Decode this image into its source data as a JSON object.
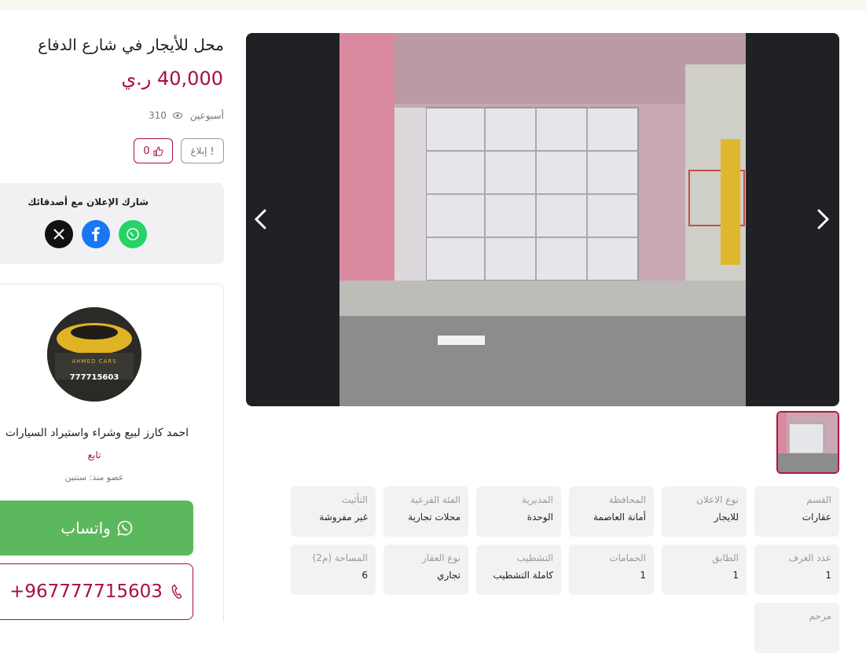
{
  "listing": {
    "title": "محل للأيجار في شارع الدفاع",
    "price": "40,000 ر.ي",
    "age": "أسبوعين",
    "views": "310",
    "likes": "0",
    "report_label": "إبلاغ"
  },
  "share": {
    "title": "شارك الإعلان مع أصدقائك",
    "icons": [
      "x-icon",
      "facebook-icon",
      "whatsapp-icon"
    ]
  },
  "seller": {
    "name": "احمد كارز لبيع وشراء واستيراد السيارات",
    "follow_label": "تابع",
    "member_since": "عضو منذ: سنتين",
    "avatar_brand": "AHMED CARS",
    "avatar_phone": "777715603",
    "whatsapp_label": "واتساب",
    "phone": "+967777715603"
  },
  "details": [
    {
      "label": "القسم",
      "value": "عقارات"
    },
    {
      "label": "نوع الاعلان",
      "value": "للايجار"
    },
    {
      "label": "المحافظة",
      "value": "أمانة العاصمة"
    },
    {
      "label": "المديرية",
      "value": "الوحدة"
    },
    {
      "label": "الفئة الفرعية",
      "value": "محلات تجارية"
    },
    {
      "label": "التأثيث",
      "value": "غير مفروشة"
    },
    {
      "label": "عدد الغرف",
      "value": "1"
    },
    {
      "label": "الطابق",
      "value": "1"
    },
    {
      "label": "الحمامات",
      "value": "1"
    },
    {
      "label": "التشطيب",
      "value": "كاملة التشطيب"
    },
    {
      "label": "نوع العقار",
      "value": "تجاري"
    },
    {
      "label": "المساحة (م2)",
      "value": "6"
    },
    {
      "label": "مرحم",
      "value": ""
    }
  ],
  "colors": {
    "accent": "#a8103a",
    "whatsapp": "#5cb85c",
    "gallery_bg": "#1f2124"
  }
}
